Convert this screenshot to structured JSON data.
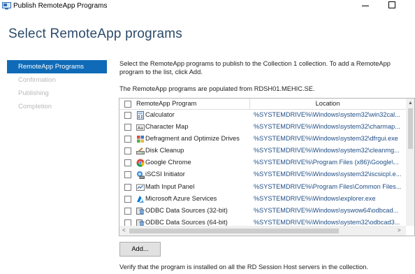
{
  "window": {
    "title": "Publish RemoteApp Programs"
  },
  "page": {
    "heading": "Select RemoteApp programs"
  },
  "nav": [
    {
      "label": "RemoteApp Programs",
      "active": true
    },
    {
      "label": "Confirmation",
      "active": false
    },
    {
      "label": "Publishing",
      "active": false
    },
    {
      "label": "Completion",
      "active": false
    }
  ],
  "description": "Select the RemoteApp programs to publish to the Collection 1 collection. To add a RemoteApp program to the list, click Add.",
  "source_text": "The RemoteApp programs are populated from RDSH01.MEHIC.SE.",
  "table": {
    "col_program": "RemoteApp Program",
    "col_location": "Location",
    "rows": [
      {
        "name": "Calculator",
        "location": "%SYSTEMDRIVE%\\Windows\\system32\\win32cal...",
        "icon": "calculator-icon"
      },
      {
        "name": "Character Map",
        "location": "%SYSTEMDRIVE%\\Windows\\system32\\charmap...",
        "icon": "character-map-icon"
      },
      {
        "name": "Defragment and Optimize Drives",
        "location": "%SYSTEMDRIVE%\\Windows\\system32\\dfrgui.exe",
        "icon": "defragment-icon"
      },
      {
        "name": "Disk Cleanup",
        "location": "%SYSTEMDRIVE%\\Windows\\system32\\cleanmg...",
        "icon": "disk-cleanup-icon"
      },
      {
        "name": "Google Chrome",
        "location": "%SYSTEMDRIVE%\\Program Files (x86)\\Google\\...",
        "icon": "chrome-icon"
      },
      {
        "name": "iSCSI Initiator",
        "location": "%SYSTEMDRIVE%\\Windows\\system32\\iscsicpl.e...",
        "icon": "iscsi-icon"
      },
      {
        "name": "Math Input Panel",
        "location": "%SYSTEMDRIVE%\\Program Files\\Common Files...",
        "icon": "math-input-icon"
      },
      {
        "name": "Microsoft Azure Services",
        "location": "%SYSTEMDRIVE%\\Windows\\explorer.exe",
        "icon": "azure-icon"
      },
      {
        "name": "ODBC Data Sources (32-bit)",
        "location": "%SYSTEMDRIVE%\\Windows\\syswow64\\odbcad...",
        "icon": "odbc-icon"
      },
      {
        "name": "ODBC Data Sources (64-bit)",
        "location": "%SYSTEMDRIVE%\\Windows\\system32\\odbcad3...",
        "icon": "odbc-icon"
      }
    ]
  },
  "buttons": {
    "add": "Add..."
  },
  "footer_text": "Verify that the program is installed on all the RD Session Host servers in the collection.",
  "colors": {
    "accent": "#0f6bb7",
    "heading": "#2c4a6a",
    "location_text": "#1f4e86"
  }
}
